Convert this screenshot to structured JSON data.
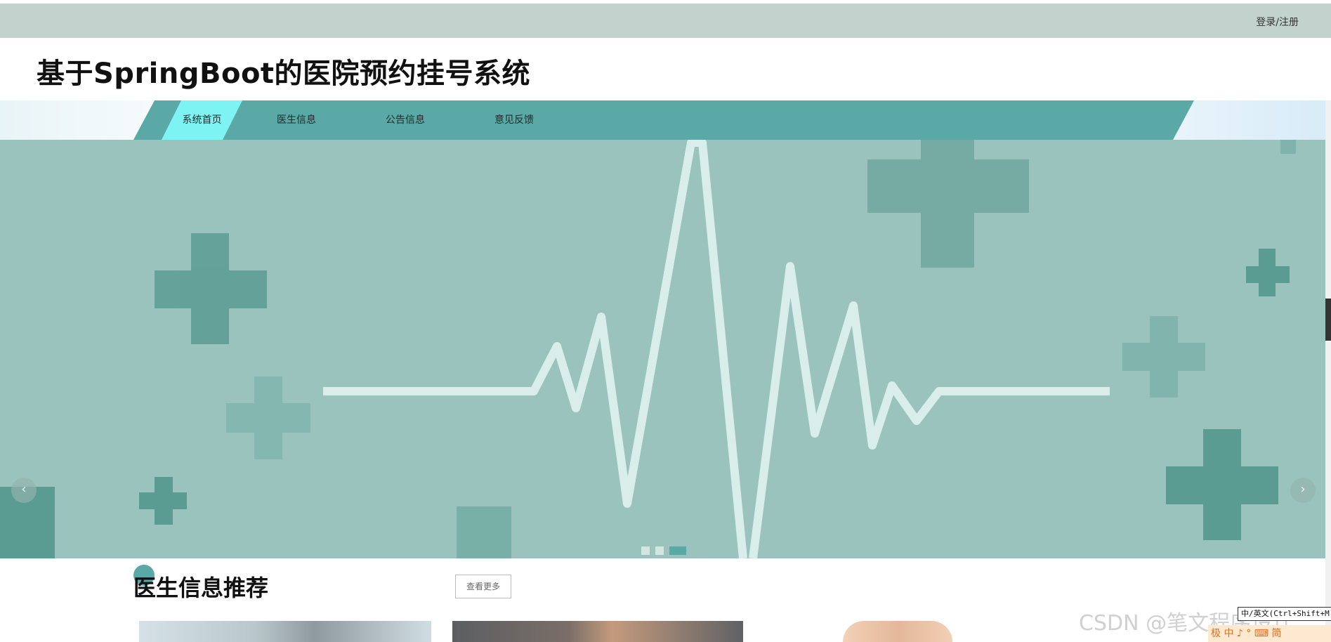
{
  "header": {
    "login_label": "登录/注册",
    "site_title": "基于SpringBoot的医院预约挂号系统"
  },
  "nav": {
    "items": [
      {
        "label": "系统首页",
        "active": true
      },
      {
        "label": "医生信息",
        "active": false
      },
      {
        "label": "公告信息",
        "active": false
      },
      {
        "label": "意见反馈",
        "active": false
      }
    ]
  },
  "banner": {
    "prev_label": "‹",
    "next_label": "›",
    "slides_count": 3,
    "active_slide": 3
  },
  "section": {
    "title": "医生信息推荐",
    "more_label": "查看更多"
  },
  "overlay": {
    "watermark": "CSDN @笔文程序设计",
    "ime_tooltip": "中/英文(Ctrl+Shift+M)",
    "ime_bar": "极 中 ♪ ° ⌨ 简"
  },
  "colors": {
    "topbar": "#c2d3cd",
    "nav_band": "#5aa9a6",
    "nav_active": "#7ef3f4",
    "banner_bg": "#99c3bc",
    "cross_dark": "#5a9f95",
    "cross_mid": "#78b0a8"
  }
}
